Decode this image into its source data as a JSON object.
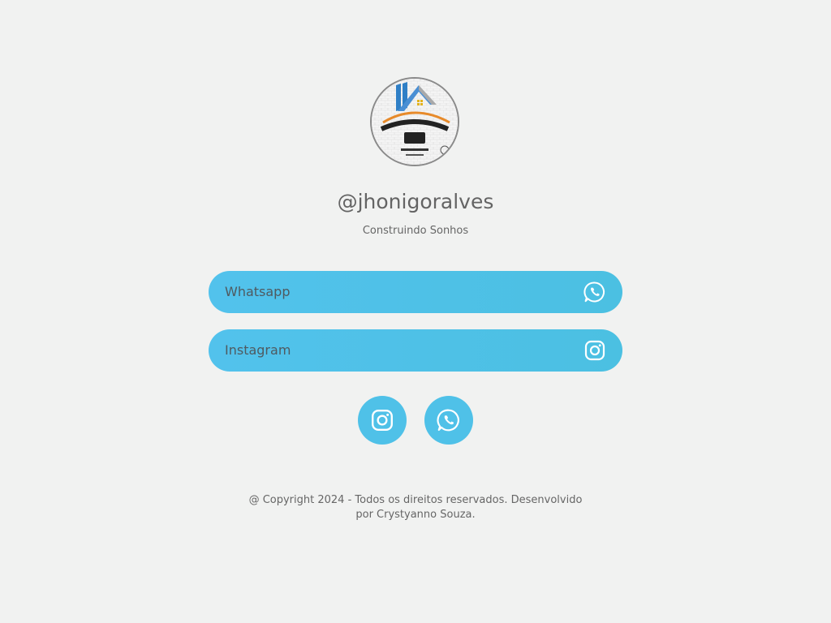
{
  "profile": {
    "handle": "@jhonigoralves",
    "tagline": "Construindo Sonhos"
  },
  "links": [
    {
      "label": "Whatsapp",
      "icon": "whatsapp-icon"
    },
    {
      "label": "Instagram",
      "icon": "instagram-icon"
    }
  ],
  "social": [
    {
      "icon": "instagram-icon"
    },
    {
      "icon": "whatsapp-icon"
    }
  ],
  "footer": {
    "text": "@ Copyright 2024 - Todos os direitos reservados. Desenvolvido por Crystyanno Souza."
  },
  "colors": {
    "background": "#f1f2f1",
    "button": "#4fc1e8",
    "text": "#646464"
  }
}
